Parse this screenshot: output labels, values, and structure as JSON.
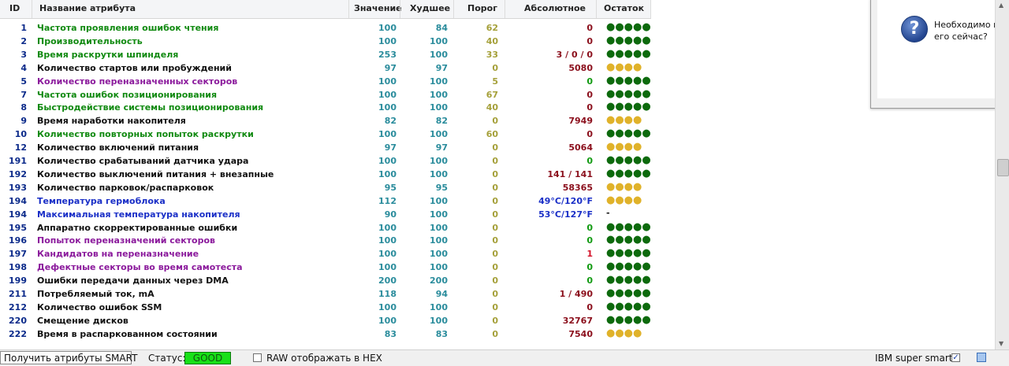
{
  "columns": {
    "id": "ID",
    "name": "Название атрибута",
    "value": "Значение",
    "worst": "Худшее",
    "threshold": "Порог",
    "absolute": "Абсолютное",
    "remain": "Остаток"
  },
  "colors": {
    "green": "#118a11",
    "purple": "#8b1a9c",
    "blue": "#1a2fc7",
    "black": "#111111",
    "abs_red": "#8b0f1c",
    "abs_green": "#119a11",
    "abs_blue": "#1a2fc7",
    "dot_green": "#0d6a0d",
    "dot_yellow": "#e0b22a"
  },
  "rows": [
    {
      "id": "1",
      "name": "Частота проявления ошибок чтения",
      "value": "100",
      "worst": "84",
      "threshold": "62",
      "absolute": "0",
      "name_color": "green",
      "abs_color": "red",
      "remain": "●●●●●",
      "remain_color": "green"
    },
    {
      "id": "2",
      "name": "Производительность",
      "value": "100",
      "worst": "100",
      "threshold": "40",
      "absolute": "0",
      "name_color": "green",
      "abs_color": "red",
      "remain": "●●●●●",
      "remain_color": "green"
    },
    {
      "id": "3",
      "name": "Время раскрутки шпинделя",
      "value": "253",
      "worst": "100",
      "threshold": "33",
      "absolute": "3 / 0 / 0",
      "name_color": "green",
      "abs_color": "red",
      "remain": "●●●●●",
      "remain_color": "green"
    },
    {
      "id": "4",
      "name": "Количество стартов или пробуждений",
      "value": "97",
      "worst": "97",
      "threshold": "0",
      "absolute": "5080",
      "name_color": "black",
      "abs_color": "red",
      "remain": "●●●●",
      "remain_color": "yellow"
    },
    {
      "id": "5",
      "name": "Количество переназначенных секторов",
      "value": "100",
      "worst": "100",
      "threshold": "5",
      "absolute": "0",
      "name_color": "purple",
      "abs_color": "green",
      "remain": "●●●●●",
      "remain_color": "green"
    },
    {
      "id": "7",
      "name": "Частота ошибок позиционирования",
      "value": "100",
      "worst": "100",
      "threshold": "67",
      "absolute": "0",
      "name_color": "green",
      "abs_color": "red",
      "remain": "●●●●●",
      "remain_color": "green"
    },
    {
      "id": "8",
      "name": "Быстродействие системы позиционирования",
      "value": "100",
      "worst": "100",
      "threshold": "40",
      "absolute": "0",
      "name_color": "green",
      "abs_color": "red",
      "remain": "●●●●●",
      "remain_color": "green"
    },
    {
      "id": "9",
      "name": "Время наработки накопителя",
      "value": "82",
      "worst": "82",
      "threshold": "0",
      "absolute": "7949",
      "name_color": "black",
      "abs_color": "red",
      "remain": "●●●●",
      "remain_color": "yellow"
    },
    {
      "id": "10",
      "name": "Количество повторных попыток раскрутки",
      "value": "100",
      "worst": "100",
      "threshold": "60",
      "absolute": "0",
      "name_color": "green",
      "abs_color": "red",
      "remain": "●●●●●",
      "remain_color": "green"
    },
    {
      "id": "12",
      "name": "Количество включений питания",
      "value": "97",
      "worst": "97",
      "threshold": "0",
      "absolute": "5064",
      "name_color": "black",
      "abs_color": "red",
      "remain": "●●●●",
      "remain_color": "yellow"
    },
    {
      "id": "191",
      "name": "Количество срабатываний датчика удара",
      "value": "100",
      "worst": "100",
      "threshold": "0",
      "absolute": "0",
      "name_color": "black",
      "abs_color": "green",
      "remain": "●●●●●",
      "remain_color": "green"
    },
    {
      "id": "192",
      "name": "Количество выключений питания + внезапные",
      "value": "100",
      "worst": "100",
      "threshold": "0",
      "absolute": "141 / 141",
      "name_color": "black",
      "abs_color": "red",
      "remain": "●●●●●",
      "remain_color": "green"
    },
    {
      "id": "193",
      "name": "Количество парковок/распарковок",
      "value": "95",
      "worst": "95",
      "threshold": "0",
      "absolute": "58365",
      "name_color": "black",
      "abs_color": "red",
      "remain": "●●●●",
      "remain_color": "yellow"
    },
    {
      "id": "194",
      "name": "Температура гермоблока",
      "value": "112",
      "worst": "100",
      "threshold": "0",
      "absolute": "49°C/120°F",
      "name_color": "blue",
      "abs_color": "blue",
      "remain": "●●●●",
      "remain_color": "yellow"
    },
    {
      "id": "194",
      "name": "Максимальная температура накопителя",
      "value": "90",
      "worst": "100",
      "threshold": "0",
      "absolute": "53°C/127°F",
      "name_color": "blue",
      "abs_color": "blue",
      "remain": "-",
      "remain_color": "black"
    },
    {
      "id": "195",
      "name": "Аппаратно скорректированные ошибки",
      "value": "100",
      "worst": "100",
      "threshold": "0",
      "absolute": "0",
      "name_color": "black",
      "abs_color": "green",
      "remain": "●●●●●",
      "remain_color": "green"
    },
    {
      "id": "196",
      "name": "Попыток переназначений секторов",
      "value": "100",
      "worst": "100",
      "threshold": "0",
      "absolute": "0",
      "name_color": "purple",
      "abs_color": "green",
      "remain": "●●●●●",
      "remain_color": "green"
    },
    {
      "id": "197",
      "name": "Кандидатов на переназначение",
      "value": "100",
      "worst": "100",
      "threshold": "0",
      "absolute": "1",
      "name_color": "purple",
      "abs_color": "red_bright",
      "remain": "●●●●●",
      "remain_color": "green"
    },
    {
      "id": "198",
      "name": "Дефектные секторы во время самотеста",
      "value": "100",
      "worst": "100",
      "threshold": "0",
      "absolute": "0",
      "name_color": "purple",
      "abs_color": "green",
      "remain": "●●●●●",
      "remain_color": "green"
    },
    {
      "id": "199",
      "name": "Ошибки передачи данных через DMA",
      "value": "200",
      "worst": "200",
      "threshold": "0",
      "absolute": "0",
      "name_color": "black",
      "abs_color": "green",
      "remain": "●●●●●",
      "remain_color": "green"
    },
    {
      "id": "211",
      "name": "Потребляемый ток, mA",
      "value": "118",
      "worst": "94",
      "threshold": "0",
      "absolute": "1 / 490",
      "name_color": "black",
      "abs_color": "red",
      "remain": "●●●●●",
      "remain_color": "green"
    },
    {
      "id": "212",
      "name": "Количество ошибок SSM",
      "value": "100",
      "worst": "100",
      "threshold": "0",
      "absolute": "0",
      "name_color": "black",
      "abs_color": "red",
      "remain": "●●●●●",
      "remain_color": "green"
    },
    {
      "id": "220",
      "name": "Смещение дисков",
      "value": "100",
      "worst": "100",
      "threshold": "0",
      "absolute": "32767",
      "name_color": "black",
      "abs_color": "red",
      "remain": "●●●●●",
      "remain_color": "green"
    },
    {
      "id": "222",
      "name": "Время в распаркованном состоянии",
      "value": "83",
      "worst": "83",
      "threshold": "0",
      "absolute": "7540",
      "name_color": "black",
      "abs_color": "red",
      "remain": "●●●●",
      "remain_color": "yellow"
    }
  ],
  "dialog": {
    "line1": "Необходимо выпол",
    "line2": "его сейчас?",
    "icon": "question-icon"
  },
  "statusbar": {
    "get_button": "Получить атрибуты SMART",
    "status_label": "Статус:",
    "status_value": "GOOD",
    "raw_label": "RAW отображать в HEX",
    "raw_checked": false,
    "ibm_label": "IBM super smart:",
    "ibm_checked": true
  }
}
